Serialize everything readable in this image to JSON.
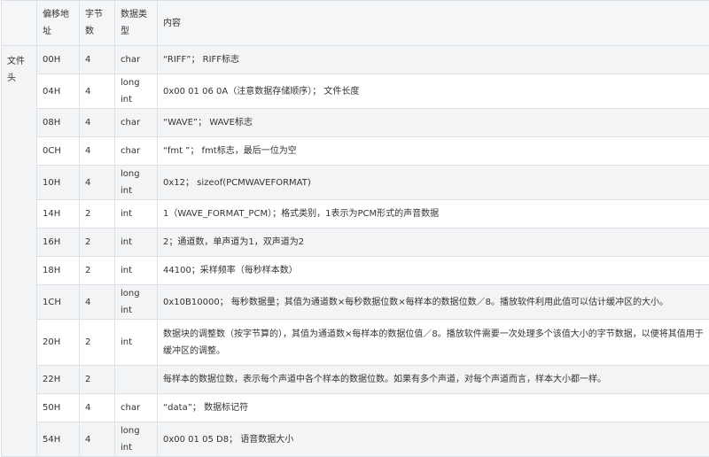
{
  "headers": [
    "",
    "偏移地址",
    "字节数",
    "数据类型",
    "内容"
  ],
  "group_label": "文件头",
  "rows": [
    {
      "offset": "00H",
      "bytes": "4",
      "type": "char",
      "content": "“RIFF”； RIFF标志"
    },
    {
      "offset": "04H",
      "bytes": "4",
      "type": "long int",
      "content": "0x00 01 06 0A（注意数据存储顺序）； 文件长度"
    },
    {
      "offset": "08H",
      "bytes": "4",
      "type": "char",
      "content": "“WAVE”； WAVE标志"
    },
    {
      "offset": "0CH",
      "bytes": "4",
      "type": "char",
      "content": "“fmt ”； fmt标志，最后一位为空"
    },
    {
      "offset": "10H",
      "bytes": "4",
      "type": "long int",
      "content": "0x12； sizeof(PCMWAVEFORMAT)"
    },
    {
      "offset": "14H",
      "bytes": "2",
      "type": "int",
      "content": "1（WAVE_FORMAT_PCM）；格式类别，1表示为PCM形式的声音数据"
    },
    {
      "offset": "16H",
      "bytes": "2",
      "type": "int",
      "content": "2；通道数，单声道为1，双声道为2"
    },
    {
      "offset": "18H",
      "bytes": "2",
      "type": "int",
      "content": "44100；采样频率（每秒样本数）"
    },
    {
      "offset": "1CH",
      "bytes": "4",
      "type": "long int",
      "content": "0x10B10000； 每秒数据量；其值为通道数×每秒数据位数×每样本的数据位数／8。播放软件利用此值可以估计缓冲区的大小。"
    },
    {
      "offset": "20H",
      "bytes": "2",
      "type": "int",
      "content": "数据块的调整数（按字节算的），其值为通道数×每样本的数据位值／8。播放软件需要一次处理多个该值大小的字节数据，以便将其值用于缓冲区的调整。"
    },
    {
      "offset": "22H",
      "bytes": "2",
      "type": "",
      "content": "每样本的数据位数，表示每个声道中各个样本的数据位数。如果有多个声道，对每个声道而言，样本大小都一样。"
    },
    {
      "offset": "50H",
      "bytes": "4",
      "type": "char",
      "content": "“data”； 数据标记符"
    },
    {
      "offset": "54H",
      "bytes": "4",
      "type": "long int",
      "content": "0x00 01 05 D8； 语音数据大小"
    }
  ]
}
